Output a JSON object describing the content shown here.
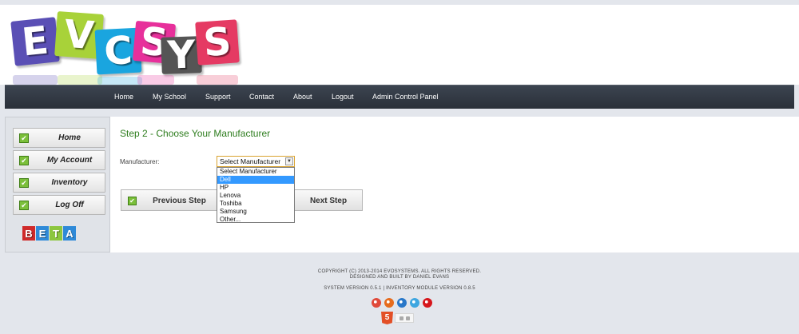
{
  "logo": {
    "letters": [
      "E",
      "V",
      "C",
      "S",
      "Y",
      "S"
    ],
    "colors": [
      "#5a4fb5",
      "#a8d239",
      "#1aa5df",
      "#e7309b",
      "#555555",
      "#e53a63"
    ]
  },
  "nav": {
    "items": [
      "Home",
      "My School",
      "Support",
      "Contact",
      "About",
      "Logout",
      "Admin Control Panel"
    ]
  },
  "sidebar": {
    "items": [
      "Home",
      "My Account",
      "Inventory",
      "Log Off"
    ],
    "beta_letters": [
      "B",
      "E",
      "T",
      "A"
    ],
    "beta_colors": [
      "#cf2a2a",
      "#2f8ad8",
      "#8cc63f",
      "#2f8ad8"
    ]
  },
  "main": {
    "title": "Step 2 - Choose Your Manufacturer",
    "manufacturer_label": "Manufacturer:",
    "select_value": "Select Manufacturer",
    "options": [
      "Select Manufacturer",
      "Dell",
      "HP",
      "Lenova",
      "Toshiba",
      "Samsung",
      "Other..."
    ],
    "highlighted_option": "Dell",
    "prev_button": "Previous Step",
    "next_button": "Next Step"
  },
  "footer": {
    "copyright": "COPYRIGHT (C) 2013-2014 EVOSYSTEMS. ALL RIGHTS RESERVED.",
    "credits": "DESIGNED AND BUILT BY DANIEL EVANS",
    "version": "SYSTEM VERSION 0.5.1 | INVENTORY MODULE VERSION 0.8.5",
    "browser_icons": [
      "chrome-icon",
      "firefox-icon",
      "ie-icon",
      "safari-icon",
      "opera-icon"
    ],
    "browser_colors": [
      "#e04a3b",
      "#e66c1e",
      "#2a78c9",
      "#3ea6e0",
      "#d6161c"
    ],
    "html5_label": "5"
  }
}
